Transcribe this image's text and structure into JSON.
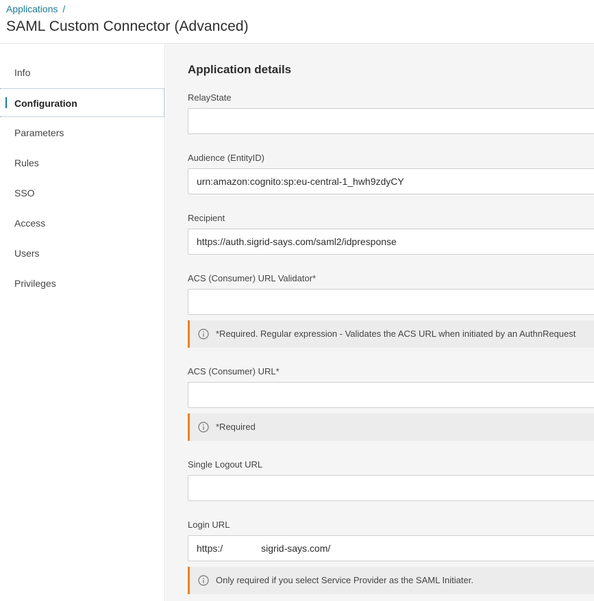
{
  "header": {
    "breadcrumb": "Applications",
    "breadcrumb_sep": "/",
    "title": "SAML Custom Connector (Advanced)"
  },
  "sidebar": {
    "items": [
      {
        "label": "Info"
      },
      {
        "label": "Configuration"
      },
      {
        "label": "Parameters"
      },
      {
        "label": "Rules"
      },
      {
        "label": "SSO"
      },
      {
        "label": "Access"
      },
      {
        "label": "Users"
      },
      {
        "label": "Privileges"
      }
    ],
    "active_item": "Configuration"
  },
  "main": {
    "section_title": "Application details",
    "fields": {
      "relay_state": {
        "label": "RelayState",
        "value": ""
      },
      "audience": {
        "label": "Audience (EntityID)",
        "value": "urn:amazon:cognito:sp:eu-central-1_hwh9zdyCY"
      },
      "recipient": {
        "label": "Recipient",
        "value": "https://auth.sigrid-says.com/saml2/idpresponse"
      },
      "acs_validator": {
        "label": "ACS (Consumer) URL Validator*",
        "value": "",
        "info": "*Required. Regular expression - Validates the ACS URL when initiated by an AuthnRequest"
      },
      "acs_url": {
        "label": "ACS (Consumer) URL*",
        "value": "",
        "info": "*Required"
      },
      "single_logout": {
        "label": "Single Logout URL",
        "value": ""
      },
      "login_url": {
        "label": "Login URL",
        "value_prefix": "https:/",
        "value_suffix": "sigrid-says.com/",
        "info": "Only required if you select Service Provider as the SAML Initiater."
      }
    }
  },
  "colors": {
    "accent": "#1b7b94",
    "warning_bar": "#e8821e",
    "info_bg": "#ececec",
    "main_bg": "#f5f5f5"
  },
  "icons": {
    "info": "info-circle-icon"
  }
}
